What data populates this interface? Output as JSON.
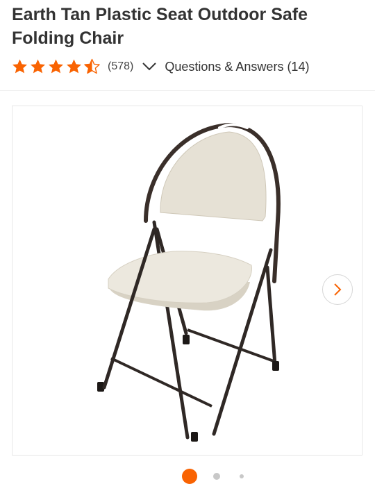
{
  "product": {
    "title": "Earth Tan Plastic Seat Outdoor Safe Folding Chair"
  },
  "rating": {
    "value": 4.5,
    "max": 5,
    "review_count_text": "(578)",
    "star_color": "#f96302"
  },
  "qa": {
    "label": "Questions & Answers (14)"
  },
  "gallery": {
    "image_icon": "folding-chair-product-photo",
    "next_icon": "chevron-right-icon",
    "accent_color": "#f96302",
    "current_index": 1,
    "total_dots": 3
  }
}
